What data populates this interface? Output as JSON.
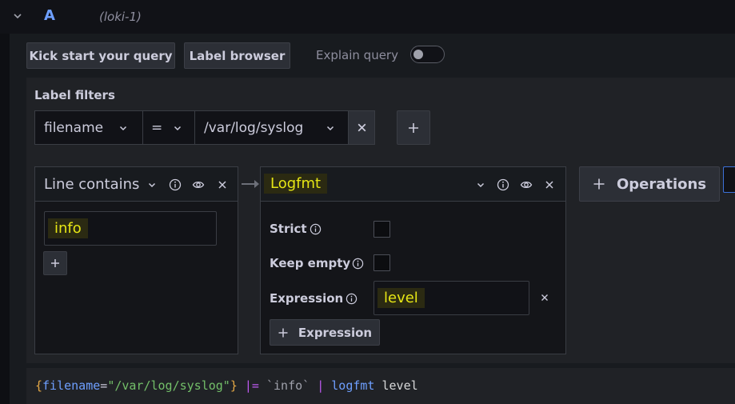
{
  "query_header": {
    "ref_id": "A",
    "datasource": "(loki-1)"
  },
  "toolbar": {
    "kick_start_label": "Kick start your query",
    "label_browser_label": "Label browser",
    "explain_label": "Explain query",
    "explain_enabled": false
  },
  "label_filters": {
    "title": "Label filters",
    "filters": [
      {
        "label": "filename",
        "operator": "=",
        "value": "/var/log/syslog"
      }
    ],
    "add_label": "+"
  },
  "operations": {
    "line_contains": {
      "title": "Line contains",
      "value": "info"
    },
    "logfmt": {
      "title": "Logfmt",
      "strict_label": "Strict",
      "strict_checked": false,
      "keep_empty_label": "Keep empty",
      "keep_empty_checked": false,
      "expression_label": "Expression",
      "expression_value": "level",
      "add_expression_label": "Expression"
    },
    "add_operations_label": "Operations"
  },
  "raw_query": {
    "tokens": [
      {
        "t": "{",
        "c": "tk-brace"
      },
      {
        "t": "filename",
        "c": "tk-label"
      },
      {
        "t": "=",
        "c": "tk-op"
      },
      {
        "t": "\"/var/log/syslog\"",
        "c": "tk-str"
      },
      {
        "t": "}",
        "c": "tk-brace"
      },
      {
        "t": " ",
        "c": "tk-plain"
      },
      {
        "t": "|=",
        "c": "tk-pipe"
      },
      {
        "t": " ",
        "c": "tk-plain"
      },
      {
        "t": "`info`",
        "c": "tk-str2"
      },
      {
        "t": " ",
        "c": "tk-plain"
      },
      {
        "t": "|",
        "c": "tk-pipe"
      },
      {
        "t": " ",
        "c": "tk-plain"
      },
      {
        "t": "logfmt",
        "c": "tk-fn"
      },
      {
        "t": " level",
        "c": "tk-plain"
      }
    ]
  },
  "colors": {
    "accent": "#6e9fff",
    "highlight": "#e6e615",
    "background": "#111217",
    "panel": "#181b1f"
  }
}
